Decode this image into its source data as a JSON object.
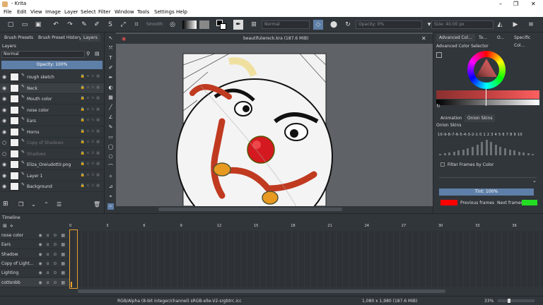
{
  "window": {
    "title": "- Krita"
  },
  "menu": [
    "File",
    "Edit",
    "View",
    "Image",
    "Layer",
    "Select",
    "Filter",
    "Window",
    "Tools",
    "Settings",
    "Help"
  ],
  "toolbar": {
    "smooth_label": "Smooth",
    "blend_mode": "Normal",
    "opacity": "Opacity: 0%",
    "size": "Size: 40.00 px"
  },
  "left_tabs": [
    "Brush Presets",
    "Brush Preset History",
    "Layers"
  ],
  "layers_panel": {
    "title": "Layers",
    "blend_mode": "Normal",
    "opacity": "Opacity: 100%",
    "layers": [
      {
        "name": "rough sketch",
        "visible": true,
        "dim": false
      },
      {
        "name": "Neck",
        "visible": true,
        "dim": false
      },
      {
        "name": "Mouth color",
        "visible": true,
        "dim": false
      },
      {
        "name": "nose color",
        "visible": true,
        "dim": false
      },
      {
        "name": "Ears",
        "visible": true,
        "dim": false
      },
      {
        "name": "Horns",
        "visible": true,
        "dim": false
      },
      {
        "name": "Copy of Shadows",
        "visible": false,
        "dim": true
      },
      {
        "name": "Shadows",
        "visible": false,
        "dim": true
      },
      {
        "name": "Eliza_Oreiudottir.png",
        "visible": true,
        "dim": false
      },
      {
        "name": "Layer 1",
        "visible": true,
        "dim": false
      },
      {
        "name": "Background",
        "visible": true,
        "dim": false
      }
    ]
  },
  "document": {
    "tab_title": "beautifulwreck.kra (187.6 MiB)"
  },
  "right_top_tabs": [
    "Advanced Col...",
    "To...",
    "O...",
    "Specific Col..."
  ],
  "color_selector": {
    "title": "Advanced Color Selector"
  },
  "right_mid_tabs": [
    "Animation",
    "Onion Skins"
  ],
  "onion_skins": {
    "title": "Onion Skins",
    "numbers_prev": "10-9-8-7-6-5-4-3-2-1",
    "zero": "0",
    "numbers_next": "1 2 3 4 5 6 7 8 9 10",
    "bar_levels": [
      0.1,
      0.15,
      0.2,
      0.25,
      0.3,
      0.35,
      0.45,
      0.55,
      0.7,
      0.85,
      1.0,
      0.85,
      0.7,
      0.55,
      0.45,
      0.35,
      0.3,
      0.25,
      0.2,
      0.15,
      0.1
    ],
    "filter_label": "Filter Frames by Color",
    "tint": "Tint: 100%",
    "prev_label": "Previous frames",
    "next_label": "Next frames",
    "prev_color": "#ff0000",
    "next_color": "#22dd22"
  },
  "timeline": {
    "title": "Timeline",
    "ruler": [
      "0",
      "3",
      "6",
      "9",
      "12",
      "15",
      "18",
      "21",
      "24",
      "27",
      "30",
      "33",
      "36"
    ],
    "rows": [
      "nose color",
      "Ears",
      "Shadow",
      "Copy of Light...",
      "Lighting",
      "cottonbb"
    ]
  },
  "status": {
    "color_info": "RGB/Alpha (8-bit integer/channel)  sRGB-elle-V2-srgbtrc.icc",
    "doc_info": "1,080 x 1,980 (187.6 MiB)",
    "zoom": "33%"
  },
  "colors": {
    "accent": "#5e7fa8",
    "onion_prev": "#ff0000",
    "onion_next": "#22dd22",
    "current_frame": "#e8a030"
  }
}
